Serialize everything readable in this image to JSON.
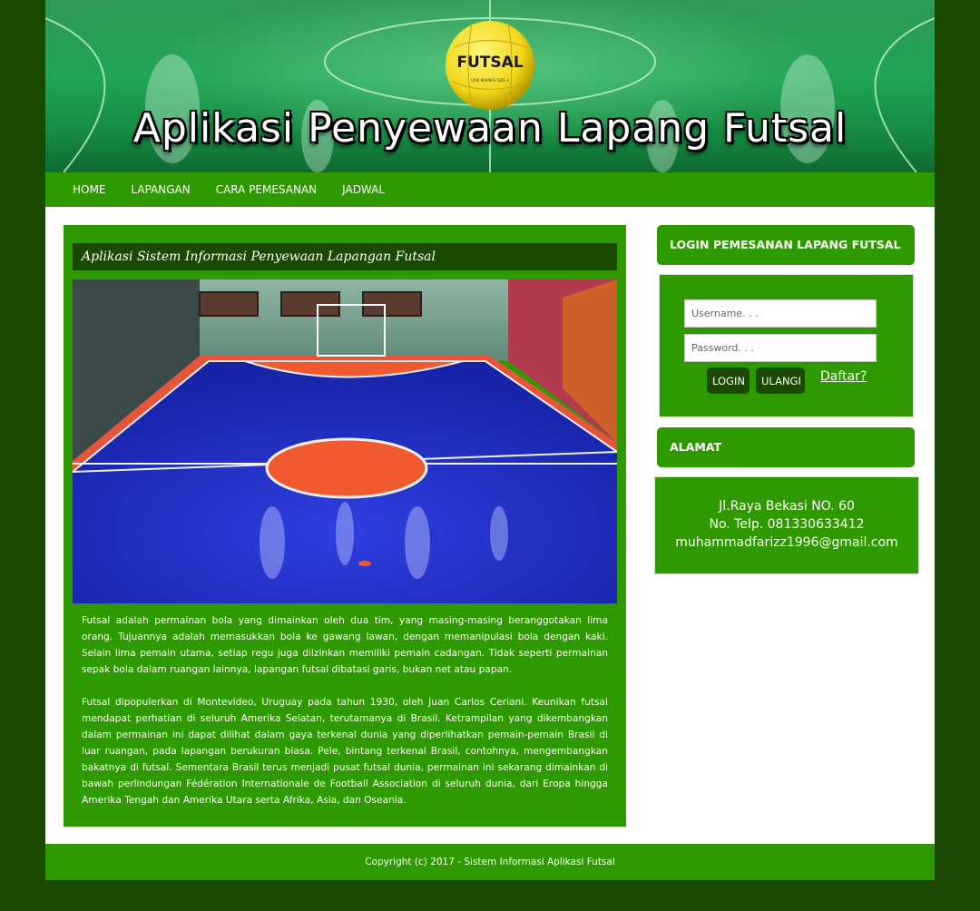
{
  "header": {
    "title": "Aplikasi Penyewaan Lapang Futsal",
    "ball_text": "FUTSAL",
    "ball_subtext": "LOW BOUNCE SIZE 4"
  },
  "nav": {
    "items": [
      "HOME",
      "LAPANGAN",
      "CARA PEMESANAN",
      "JADWAL"
    ]
  },
  "content": {
    "title": "Aplikasi Sistem Informasi Penyewaan Lapangan Futsal",
    "image_icon": "futsal-court-photo",
    "paragraphs": [
      "Futsal adalah permainan bola yang dimainkan oleh dua tim, yang masing-masing beranggotakan lima orang. Tujuannya adalah memasukkan bola ke gawang lawan, dengan memanipulasi bola dengan kaki. Selain lima pemain utama, setiap regu juga diizinkan memiliki pemain cadangan. Tidak seperti permainan sepak bola dalam ruangan lainnya, lapangan futsal dibatasi garis, bukan net atau papan.",
      "Futsal dipopulerkan di Montevideo, Uruguay pada tahun 1930, oleh Juan Carlos Ceriani. Keunikan futsal mendapat perhatian di seluruh Amerika Selatan, terutamanya di Brasil. Ketrampilan yang dikembangkan dalam permainan ini dapat dilihat dalam gaya terkenal dunia yang diperlihatkan pemain-pemain Brasil di luar ruangan, pada lapangan berukuran biasa. Pele, bintang terkenal Brasil, contohnya, mengembangkan bakatnya di futsal. Sementara Brasil terus menjadi pusat futsal dunia, permainan ini sekarang dimainkan di bawah perlindungan Fédération Internationale de Football Association di seluruh dunia, dari Eropa hingga Amerika Tengah dan Amerika Utara serta Afrika, Asia, dan Oseania."
    ]
  },
  "login": {
    "heading": "LOGIN PEMESANAN LAPANG FUTSAL",
    "username_placeholder": "Username. . .",
    "password_placeholder": "Password. . .",
    "login_label": "LOGIN",
    "reset_label": "ULANGI",
    "register_label": "Daftar?"
  },
  "address": {
    "heading": "ALAMAT",
    "street": "Jl.Raya Bekasi NO. 60",
    "phone": "No. Telp. 081330633412",
    "email": "muhammadfarizz1996@gmail.com"
  },
  "footer": {
    "copyright": "Copyright (c) 2017 - Sistem Informasi Aplikasi Futsal"
  },
  "colors": {
    "page_bg": "#1b4a04",
    "green": "#2f9a00",
    "dark_green": "#1a4a00",
    "court_blue": "#1f2fc4",
    "court_orange": "#ff5a2a"
  }
}
